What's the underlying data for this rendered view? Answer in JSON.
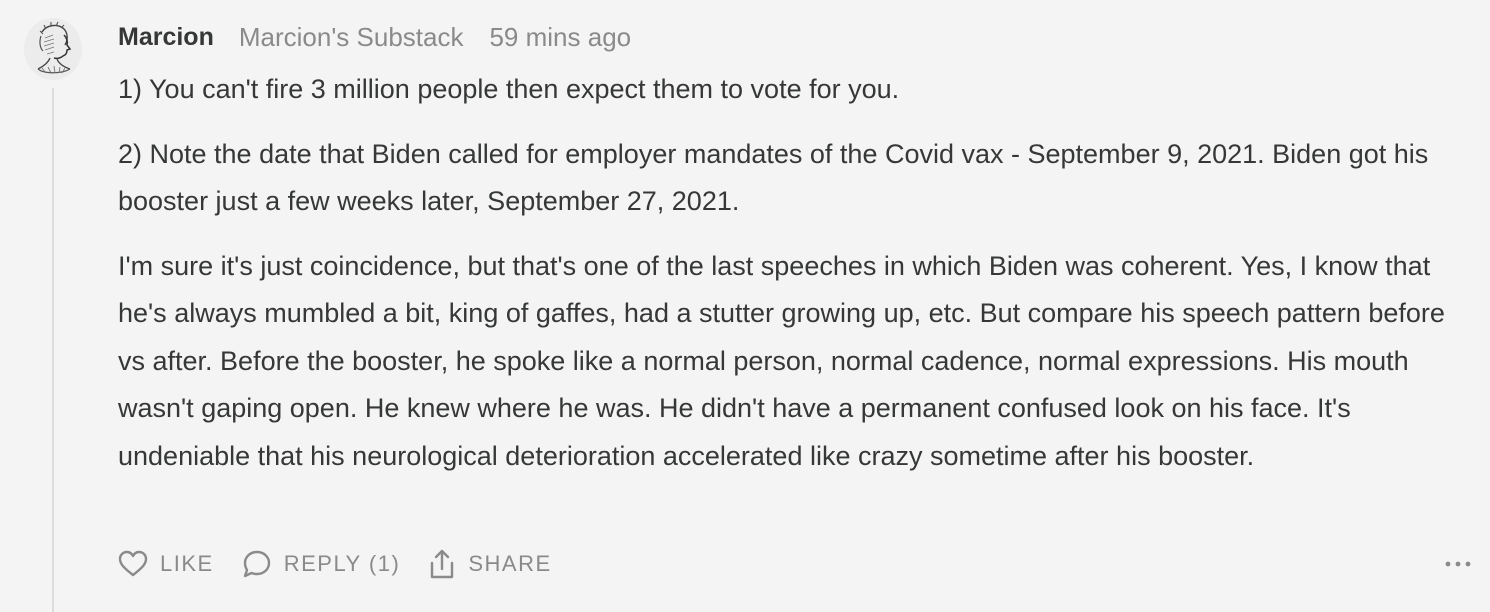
{
  "comment": {
    "author": "Marcion",
    "publication": "Marcion's Substack",
    "timestamp": "59 mins ago",
    "paragraphs": [
      "1) You can't fire 3 million people then expect them to vote for you.",
      "2) Note the date that Biden called for employer mandates of the Covid vax - September 9, 2021. Biden got his booster just a few weeks later, September 27, 2021.",
      "I'm sure it's just coincidence, but that's one of the last speeches in which Biden was coherent. Yes, I know that he's always mumbled a bit, king of gaffes, had a stutter growing up, etc. But compare his speech pattern before vs after. Before the booster, he spoke like a normal person, normal cadence, normal expressions. His mouth wasn't gaping open. He knew where he was. He didn't have a permanent confused look on his face. It's undeniable that his neurological deterioration accelerated like crazy sometime after his booster."
    ]
  },
  "actions": {
    "like_label": "LIKE",
    "reply_label": "REPLY (1)",
    "share_label": "SHARE"
  },
  "icons": {
    "like": "heart-icon",
    "reply": "speech-bubble-icon",
    "share": "share-icon",
    "more": "ellipsis-icon"
  },
  "colors": {
    "background": "#f4f4f4",
    "text": "#363737",
    "muted": "#8a8a8a",
    "thread_line": "#dcdcdc"
  }
}
